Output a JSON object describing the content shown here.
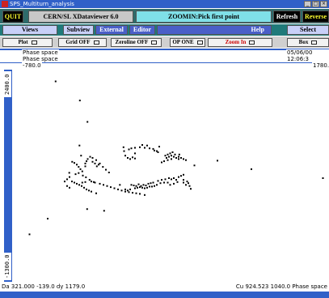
{
  "window": {
    "title": "SPS_Multiturn_analysis"
  },
  "toolbar1": {
    "quit": "QUIT",
    "app_title": "CERN/SL XDataviewer 6.0",
    "status": "ZOOMIN:Pick first point",
    "refresh": "Refresh",
    "reverse": "Reverse"
  },
  "toolbar2": {
    "views": "Views",
    "subview": "Subview",
    "external": "External",
    "editor": "Editor",
    "help": "Help",
    "select": "Select"
  },
  "toolbar3": {
    "plot": "Plot",
    "grid": "Grid OFF",
    "zeroline": "Zeroline OFF",
    "opone": "OP ONE",
    "zoom": "Zoom In",
    "box": "Box"
  },
  "plot": {
    "label_top1": "Phase space",
    "label_top2": "Phase space",
    "xmin": "-780.0",
    "xmax": "1780.",
    "datetime": "05/06/00 12:06:3",
    "ytop": "2400.0",
    "ybottom": "-1300.0"
  },
  "status": {
    "left": "Da 321.000  -139.0 dy 1179.0",
    "right": "Cu 924.523  1040.0 Phase space"
  },
  "chart_data": {
    "type": "scatter",
    "title": "Phase space",
    "xlim": [
      -780.0,
      1780.0
    ],
    "ylim": [
      -1300.0,
      2400.0
    ],
    "points": [
      [
        -455,
        2220
      ],
      [
        -255,
        1880
      ],
      [
        -192,
        1500
      ],
      [
        -258,
        1080
      ],
      [
        -210,
        710
      ],
      [
        -245,
        900
      ],
      [
        -318,
        790
      ],
      [
        -342,
        595
      ],
      [
        1160,
        660
      ],
      [
        1750,
        500
      ],
      [
        -120,
        230
      ],
      [
        -195,
        -50
      ],
      [
        -520,
        -220
      ],
      [
        -670,
        -500
      ],
      [
        -55,
        -80
      ],
      [
        75,
        380
      ],
      [
        105,
        1050
      ],
      [
        260,
        1090
      ],
      [
        400,
        1060
      ],
      [
        300,
        1080
      ],
      [
        200,
        940
      ],
      [
        565,
        920
      ],
      [
        690,
        725
      ],
      [
        880,
        810
      ],
      [
        -300,
        770
      ],
      [
        -280,
        740
      ],
      [
        -265,
        700
      ],
      [
        -250,
        660
      ],
      [
        -235,
        620
      ],
      [
        -265,
        590
      ],
      [
        -290,
        570
      ],
      [
        -230,
        545
      ],
      [
        -205,
        515
      ],
      [
        -175,
        470
      ],
      [
        -140,
        430
      ],
      [
        -115,
        710
      ],
      [
        -90,
        760
      ],
      [
        -65,
        700
      ],
      [
        -40,
        650
      ],
      [
        -15,
        600
      ],
      [
        -120,
        820
      ],
      [
        -150,
        860
      ],
      [
        -170,
        880
      ],
      [
        -190,
        840
      ],
      [
        -200,
        800
      ],
      [
        -210,
        760
      ],
      [
        -150,
        790
      ],
      [
        -130,
        760
      ],
      [
        -100,
        740
      ],
      [
        460,
        860
      ],
      [
        480,
        880
      ],
      [
        500,
        900
      ],
      [
        520,
        880
      ],
      [
        540,
        860
      ],
      [
        560,
        840
      ],
      [
        500,
        840
      ],
      [
        470,
        820
      ],
      [
        440,
        800
      ],
      [
        420,
        780
      ],
      [
        490,
        940
      ],
      [
        510,
        960
      ],
      [
        530,
        920
      ],
      [
        470,
        920
      ],
      [
        450,
        900
      ],
      [
        560,
        880
      ],
      [
        580,
        860
      ],
      [
        600,
        840
      ],
      [
        620,
        820
      ],
      [
        110,
        980
      ],
      [
        150,
        1010
      ],
      [
        170,
        1030
      ],
      [
        200,
        1040
      ],
      [
        240,
        1050
      ],
      [
        280,
        1040
      ],
      [
        320,
        1030
      ],
      [
        350,
        1020
      ],
      [
        360,
        990
      ],
      [
        380,
        980
      ],
      [
        390,
        960
      ],
      [
        120,
        900
      ],
      [
        140,
        860
      ],
      [
        160,
        840
      ],
      [
        180,
        870
      ],
      [
        200,
        850
      ],
      [
        170,
        380
      ],
      [
        190,
        370
      ],
      [
        210,
        360
      ],
      [
        230,
        390
      ],
      [
        250,
        360
      ],
      [
        270,
        380
      ],
      [
        290,
        370
      ],
      [
        310,
        400
      ],
      [
        330,
        410
      ],
      [
        350,
        420
      ],
      [
        240,
        340
      ],
      [
        260,
        330
      ],
      [
        280,
        320
      ],
      [
        300,
        330
      ],
      [
        220,
        330
      ],
      [
        200,
        320
      ],
      [
        160,
        300
      ],
      [
        140,
        280
      ],
      [
        120,
        300
      ],
      [
        390,
        450
      ],
      [
        420,
        470
      ],
      [
        450,
        480
      ],
      [
        480,
        500
      ],
      [
        500,
        480
      ],
      [
        520,
        500
      ],
      [
        540,
        470
      ],
      [
        560,
        520
      ],
      [
        580,
        540
      ],
      [
        600,
        560
      ],
      [
        550,
        430
      ],
      [
        520,
        400
      ],
      [
        490,
        380
      ],
      [
        470,
        420
      ],
      [
        440,
        420
      ],
      [
        410,
        410
      ],
      [
        380,
        380
      ],
      [
        360,
        360
      ],
      [
        340,
        350
      ],
      [
        320,
        350
      ],
      [
        600,
        470
      ],
      [
        630,
        440
      ],
      [
        600,
        420
      ],
      [
        620,
        380
      ],
      [
        640,
        410
      ],
      [
        650,
        360
      ],
      [
        660,
        310
      ],
      [
        -340,
        520
      ],
      [
        -360,
        480
      ],
      [
        -380,
        440
      ],
      [
        -320,
        440
      ],
      [
        -300,
        420
      ],
      [
        -280,
        400
      ],
      [
        -260,
        380
      ],
      [
        -240,
        360
      ],
      [
        -220,
        330
      ],
      [
        -200,
        300
      ],
      [
        -180,
        280
      ],
      [
        -160,
        260
      ],
      [
        -360,
        360
      ],
      [
        -340,
        330
      ],
      [
        -235,
        420
      ],
      [
        -210,
        430
      ],
      [
        -160,
        440
      ],
      [
        -130,
        420
      ],
      [
        -90,
        400
      ],
      [
        -60,
        380
      ],
      [
        -30,
        360
      ],
      [
        0,
        340
      ],
      [
        30,
        320
      ],
      [
        60,
        300
      ],
      [
        90,
        280
      ],
      [
        120,
        260
      ],
      [
        150,
        250
      ],
      [
        180,
        240
      ],
      [
        210,
        230
      ],
      [
        240,
        220
      ],
      [
        280,
        200
      ]
    ]
  }
}
